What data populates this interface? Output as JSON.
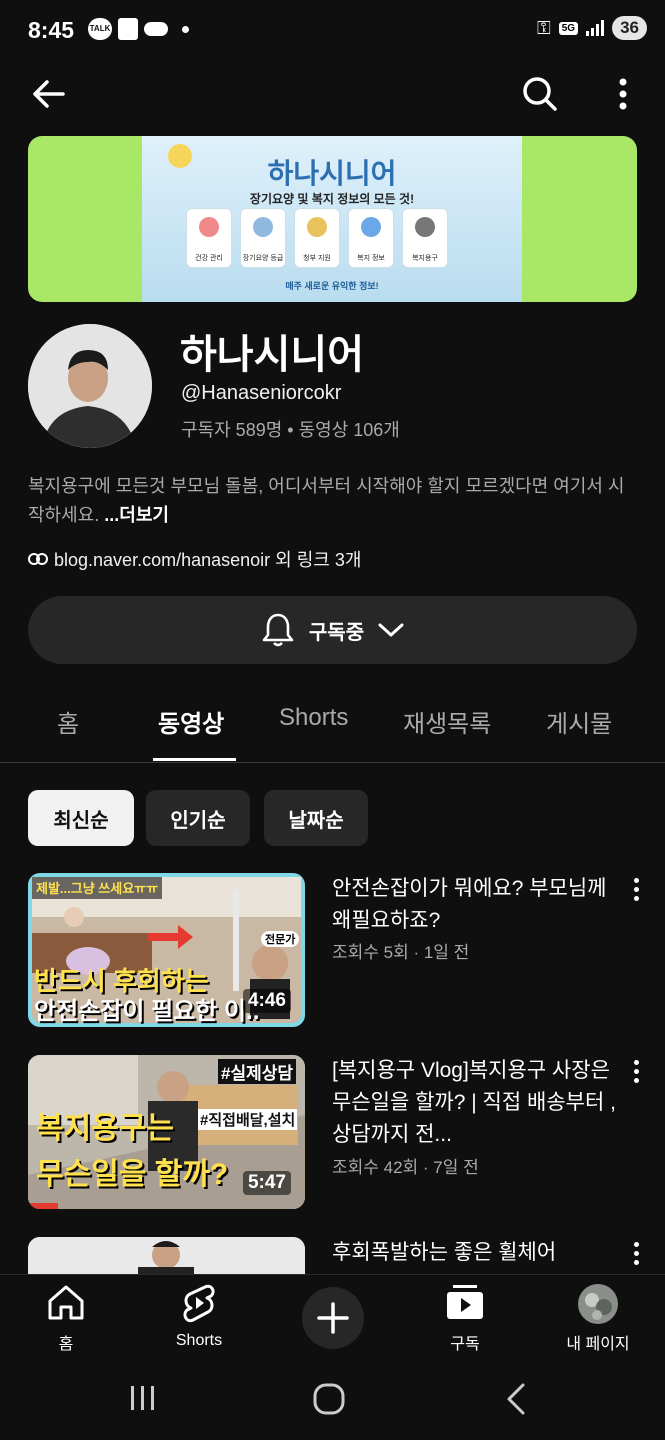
{
  "status_bar": {
    "time": "8:45",
    "talk_label": "TALK",
    "network": "5G",
    "battery": "36"
  },
  "banner": {
    "title": "하나시니어",
    "subtitle": "장기요양 및 복지 정보의 모든 것!",
    "cards": [
      "건강 관리",
      "장기요양 등급",
      "청부 지원",
      "복지 정보",
      "복지용구"
    ],
    "footer": "매주 새로운 유익한 정보!"
  },
  "channel": {
    "name": "하나시니어",
    "handle": "@Hanaseniorcokr",
    "stats": "구독자 589명 • 동영상 106개",
    "description": "복지용구에 모든것 부모님 돌봄, 어디서부터 시작해야 할지 모르겠다면 여기서 시작하세요.",
    "more_label": "...더보기",
    "link_text": "blog.naver.com/hanasenoir 외 링크 3개",
    "subscribe_label": "구독중"
  },
  "tabs": [
    "홈",
    "동영상",
    "Shorts",
    "재생목록",
    "게시물"
  ],
  "active_tab": "동영상",
  "chips": [
    "최신순",
    "인기순",
    "날짜순"
  ],
  "active_chip": "최신순",
  "videos": [
    {
      "title": "안전손잡이가 뭐에요? 부모님께 왜필요하죠?",
      "meta": "조회수 5회 · 1일 전",
      "duration": "4:46",
      "thumb_top_text": "제발...그냥 쓰세요ㅠㅠ",
      "thumb_line1": "반드시 후회하는",
      "thumb_line2": "안전손잡이 필요한 이..",
      "thumb_badge": "전문가"
    },
    {
      "title": "[복지용구 Vlog]복지용구 사장은 무슨일을 할까? | 직접 배송부터 , 상담까지 전...",
      "meta": "조회수 42회 · 7일 전",
      "duration": "5:47",
      "thumb_tag1": "#실제상담",
      "thumb_tag2": "#직접배달,설치",
      "thumb_line1": "복지용구는",
      "thumb_line2": "무슨일을 할까?"
    },
    {
      "title": "후회폭발하는 좋은 휠체어",
      "meta": ""
    }
  ],
  "bottom_nav": {
    "home": "홈",
    "shorts": "Shorts",
    "subscriptions": "구독",
    "profile": "내 페이지"
  },
  "colors": {
    "background": "#0f0f0f",
    "chip_bg": "#272727",
    "banner_green": "#a9e866",
    "secondary_text": "#aaaaaa"
  }
}
